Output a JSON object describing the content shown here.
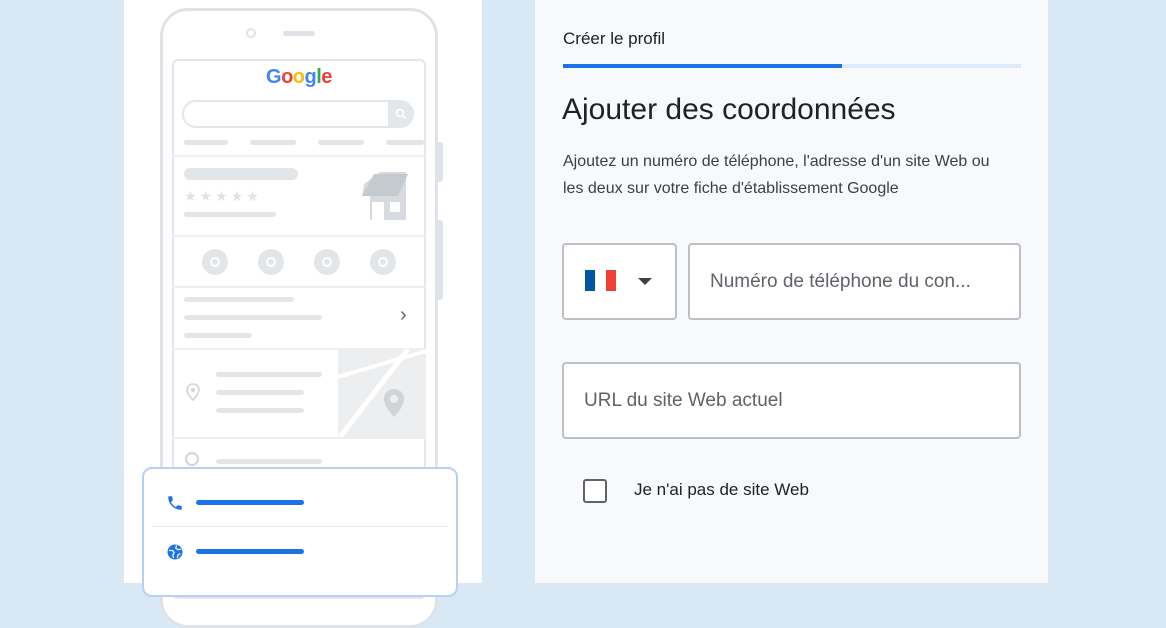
{
  "illustration": {
    "logo_letters": [
      {
        "char": "G",
        "color": "#4285F4"
      },
      {
        "char": "o",
        "color": "#EA4335"
      },
      {
        "char": "o",
        "color": "#FBBC05"
      },
      {
        "char": "g",
        "color": "#4285F4"
      },
      {
        "char": "l",
        "color": "#34A853"
      },
      {
        "char": "e",
        "color": "#EA4335"
      }
    ],
    "rating_stars": "★★★★★",
    "chevron": "›",
    "card_icons": [
      "phone-icon",
      "globe-icon"
    ]
  },
  "form": {
    "tab_title": "Créer le profil",
    "progress_fraction": 0.61,
    "heading": "Ajouter des coordonnées",
    "description": "Ajoutez un numéro de téléphone, l'adresse d'un site Web ou les deux sur votre fiche d'établissement Google",
    "country_flag": [
      "#0055A4",
      "#FFFFFF",
      "#EF4135"
    ],
    "phone_placeholder": "Numéro de téléphone du con...",
    "website_placeholder": "URL du site Web actuel",
    "no_website_label": "Je n'ai pas de site Web",
    "no_website_checked": false
  },
  "colors": {
    "accent": "#1a73e8",
    "background": "#d9e8f5"
  }
}
